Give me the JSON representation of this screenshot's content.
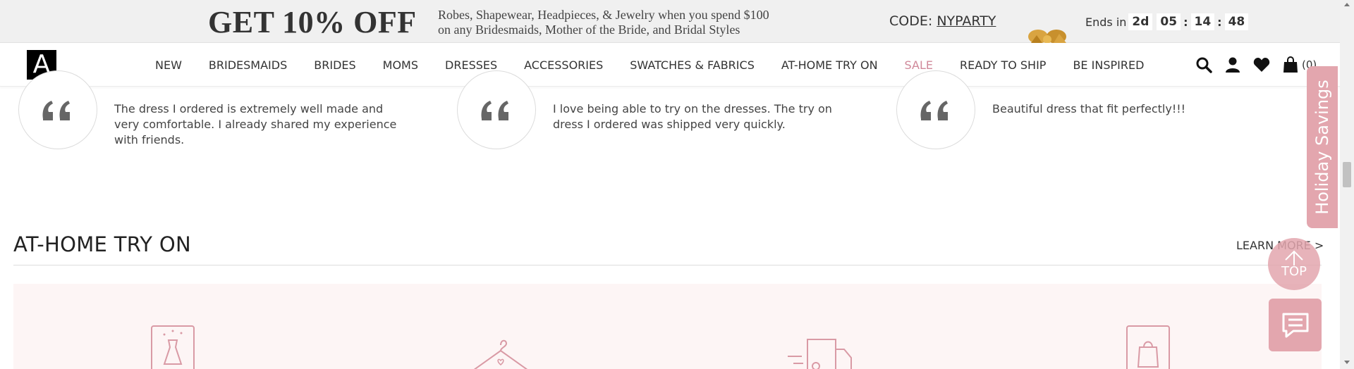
{
  "promo": {
    "headline": "GET 10% OFF",
    "desc_line1": "Robes, Shapewear, Headpieces, & Jewelry when you spend $100",
    "desc_line2": "on any Bridesmaids, Mother of the Bride, and Bridal Styles",
    "code_label": "CODE:",
    "code_value": "NYPARTY",
    "ends_label": "Ends in",
    "days": "2d",
    "hours": "05",
    "minutes": "14",
    "seconds": "48",
    "sep": ":"
  },
  "nav": {
    "logo": "A",
    "links": [
      "NEW",
      "BRIDESMAIDS",
      "BRIDES",
      "MOMS",
      "DRESSES",
      "ACCESSORIES",
      "SWATCHES & FABRICS",
      "AT-HOME TRY ON",
      "SALE",
      "READY TO SHIP",
      "BE INSPIRED"
    ],
    "bag_count": "(0)",
    "icons": [
      "search-icon",
      "account-icon",
      "wishlist-icon",
      "bag-icon"
    ]
  },
  "testimonials": [
    {
      "text": "The dress I ordered is extremely well made and very comfortable. I already shared my experience with friends."
    },
    {
      "text": "I love being able to try on the dresses. The try on dress I ordered was shipped very quickly."
    },
    {
      "text": "Beautiful dress that fit perfectly!!!"
    }
  ],
  "section": {
    "title": "AT-HOME TRY ON",
    "learn_more": "LEARN MORE >"
  },
  "widgets": {
    "holiday": "Holiday Savings",
    "top": "TOP"
  },
  "colors": {
    "accent_pink": "#e3a6ae",
    "sale": "#d0899a",
    "icon_pink": "#d99aa5",
    "promo_bg": "#f0f0f0",
    "panel_bg": "#fdf5f5"
  }
}
